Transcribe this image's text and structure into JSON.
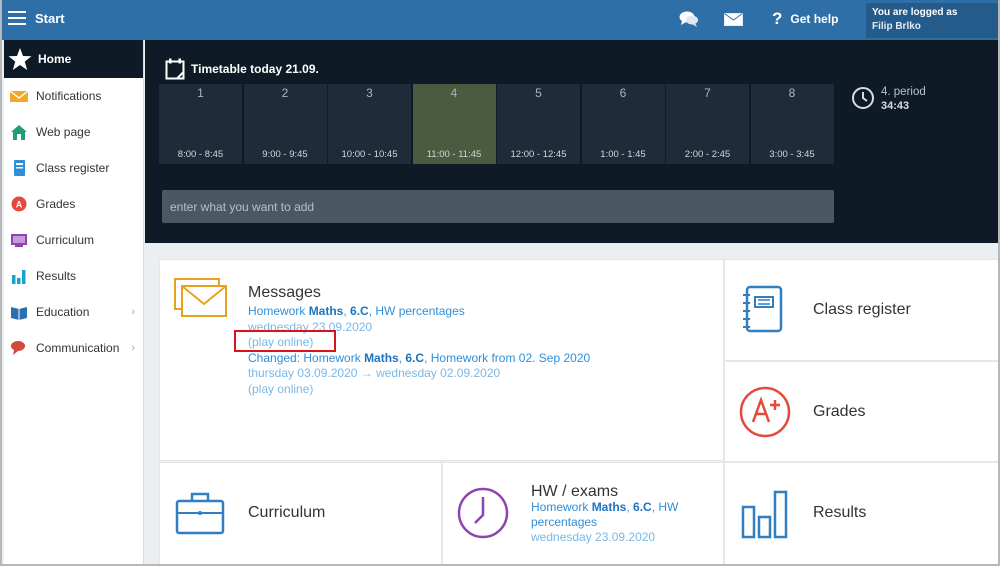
{
  "topbar": {
    "title": "Start",
    "chat_icon": "chat-bubbles-icon",
    "mail_icon": "envelope-icon",
    "help_label": "Get help",
    "user_line1": "You are logged as",
    "user_line2": "Filip Brlko"
  },
  "sidebar": {
    "home_label": "Home",
    "items": [
      {
        "label": "Notifications",
        "icon": "envelope-icon"
      },
      {
        "label": "Web page",
        "icon": "house-icon"
      },
      {
        "label": "Class register",
        "icon": "notebook-icon"
      },
      {
        "label": "Grades",
        "icon": "grade-icon"
      },
      {
        "label": "Curriculum",
        "icon": "curriculum-icon"
      },
      {
        "label": "Results",
        "icon": "bar-chart-icon"
      },
      {
        "label": "Education",
        "icon": "book-icon"
      },
      {
        "label": "Communication",
        "icon": "speech-icon"
      }
    ]
  },
  "timetable": {
    "title": "Timetable today 21.09.",
    "slots": [
      {
        "num": "1",
        "time": "8:00 - 8:45"
      },
      {
        "num": "2",
        "time": "9:00 - 9:45"
      },
      {
        "num": "3",
        "time": "10:00 - 10:45"
      },
      {
        "num": "4",
        "time": "11:00 - 11:45"
      },
      {
        "num": "5",
        "time": "12:00 - 12:45"
      },
      {
        "num": "6",
        "time": "1:00 - 1:45"
      },
      {
        "num": "7",
        "time": "2:00 - 2:45"
      },
      {
        "num": "8",
        "time": "3:00 - 3:45"
      }
    ],
    "active_slot": "4",
    "period_label": "4. period",
    "period_time": "34:43",
    "add_placeholder": "enter what you want to add"
  },
  "messages": {
    "title": "Messages",
    "item1": {
      "prefix": "Homework ",
      "subject": "Maths",
      "sep": ", ",
      "cls": "6.C",
      "rest": ", HW percentages",
      "date": "wednesday 23.09.2020",
      "play": "(play online)"
    },
    "item2": {
      "prefix": "Changed: Homework ",
      "subject": "Maths",
      "sep": ", ",
      "cls": "6.C",
      "rest": ", Homework from 02. Sep 2020",
      "date": "thursday 03.09.2020 → wednesday 02.09.2020",
      "play": "(play online)"
    }
  },
  "tiles": {
    "class_register": "Class register",
    "grades": "Grades",
    "curriculum": "Curriculum",
    "results": "Results",
    "hw_title": "HW / exams",
    "hw_prefix": "Homework ",
    "hw_subject": "Maths",
    "hw_sep": ", ",
    "hw_cls": "6.C",
    "hw_rest": ", HW percentages",
    "hw_date": "wednesday 23.09.2020"
  },
  "colors": {
    "topbar": "#2f6fa8",
    "dark": "#0e1b27",
    "accent_orange": "#e8a21e",
    "accent_blue": "#2f8fd8",
    "highlight_red": "#d9121b"
  }
}
